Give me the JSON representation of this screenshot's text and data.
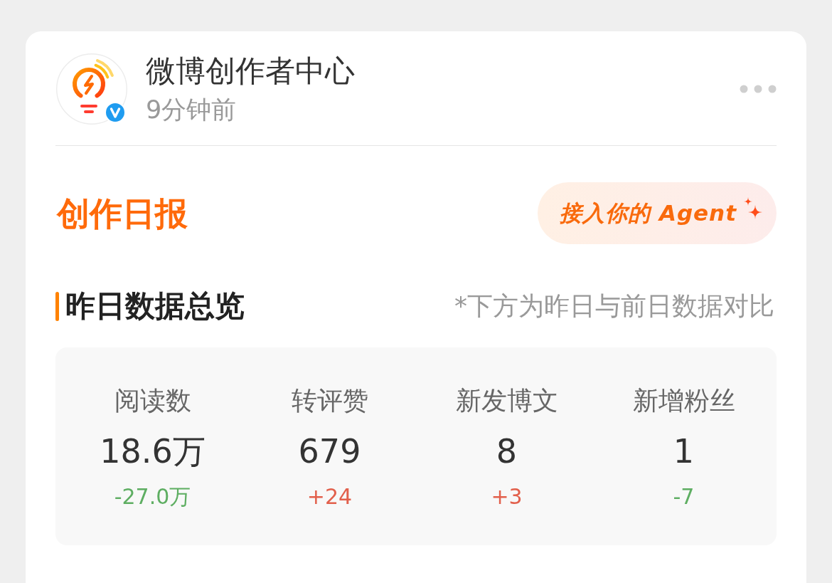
{
  "post_header": {
    "author": "微博创作者中心",
    "time": "9分钟前",
    "verified": true
  },
  "report": {
    "title": "创作日报",
    "agent_button": "接入你的 Agent"
  },
  "overview": {
    "title": "昨日数据总览",
    "note": "*下方为昨日与前日数据对比",
    "stats": [
      {
        "label": "阅读数",
        "value": "18.6万",
        "change": "-27.0万",
        "color": "#5eae62"
      },
      {
        "label": "转评赞",
        "value": "679",
        "change": "+24",
        "color": "#e2604c"
      },
      {
        "label": "新发博文",
        "value": "8",
        "change": "+3",
        "color": "#e2604c"
      },
      {
        "label": "新增粉丝",
        "value": "1",
        "change": "-7",
        "color": "#5eae62"
      }
    ]
  }
}
